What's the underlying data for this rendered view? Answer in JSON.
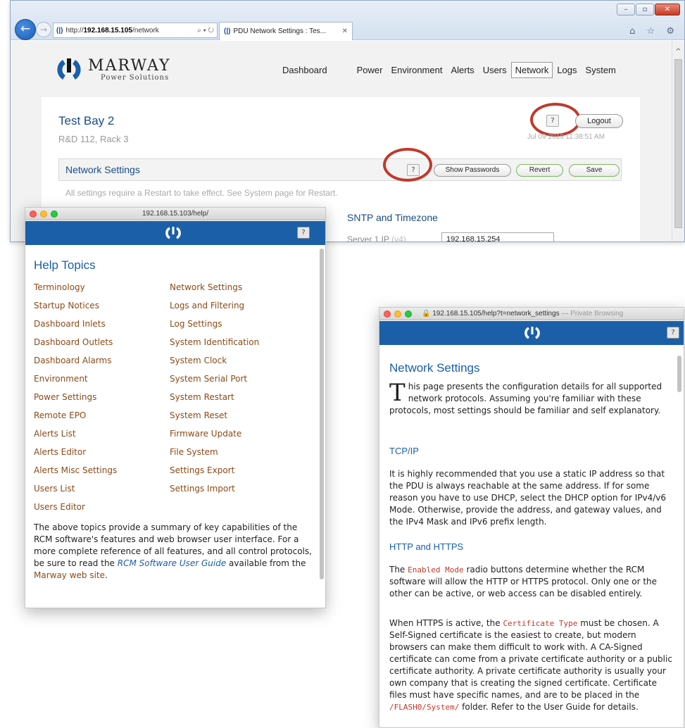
{
  "ie": {
    "window_controls": [
      "–",
      "▫",
      "✕"
    ],
    "url_prefix": "http://",
    "url_host": "192.168.15.105",
    "url_path": "/network",
    "addr_tools": "⌕ ▾ ↻",
    "tab_title": "PDU Network Settings : Tes...",
    "tab_close": "✕",
    "toolbar_icons": "⌂ ☆ ⚙",
    "scroll_up": "^"
  },
  "site": {
    "logo_name": "MARWAY",
    "logo_sub": "Power Solutions",
    "nav": [
      "Dashboard",
      "Power",
      "Environment",
      "Alerts",
      "Users",
      "Network",
      "Logs",
      "System"
    ],
    "active_nav": "Network",
    "title": "Test Bay 2",
    "subtitle": "R&D 112, Rack 3",
    "help_label": "?",
    "logout_label": "Logout",
    "timestamp": "Jul 09 2019 11:38:51 AM",
    "section_title": "Network Settings",
    "show_passwords_label": "Show Passwords",
    "revert_label": "Revert",
    "save_label": "Save",
    "note": "All settings require a Restart to take effect. See System page for Restart.",
    "sntp_title": "SNTP and Timezone",
    "server_label": "Server 1 IP",
    "server_label_suffix": "(v4)",
    "server_value": "192.168.15.254"
  },
  "help_index": {
    "window_url": "192.168.15.103/help/",
    "help_label": "?",
    "heading": "Help Topics",
    "topics_left": [
      "Terminology",
      "Startup Notices",
      "Dashboard Inlets",
      "Dashboard Outlets",
      "Dashboard Alarms",
      "Environment",
      "Power Settings",
      "Remote EPO",
      "Alerts List",
      "Alerts Editor",
      "Alerts Misc Settings",
      "Users List",
      "Users Editor"
    ],
    "topics_right": [
      "Network Settings",
      "Logs and Filtering",
      "Log Settings",
      "System Identification",
      "System Clock",
      "System Serial Port",
      "System Restart",
      "System Reset",
      "Firmware Update",
      "File System",
      "Settings Export",
      "Settings Import"
    ],
    "para_1": "The above topics provide a summary of key capabilities of the RCM software's features and web browser user interface. For a more complete reference of all features, and all control protocols, be sure to read the ",
    "para_link": "RCM Software User Guide",
    "para_2": " available from the ",
    "para_link_2": "Marway web site",
    "para_3": "."
  },
  "help_page": {
    "window_url": "192.168.15.105/help?t=network_settings",
    "private_note": " — Private Browsing",
    "help_label": "?",
    "heading": "Network Settings",
    "intro_cap": "T",
    "intro_rest": "his page presents the configuration details for all supported network protocols. Assuming you're familiar with these protocols, most settings should be familiar and self explanatory.",
    "tcp_heading": "TCP/IP",
    "tcp_para": "It is highly recommended that you use a static IP address so that the PDU is always reachable at the same address. If for some reason you have to use DHCP, select the DHCP option for IPv4/v6 Mode. Otherwise, provide the address, and gateway values, and the IPv4 Mask and IPv6 prefix length.",
    "http_heading": "HTTP and HTTPS",
    "http_p1_a": "The ",
    "http_p1_code": "Enabled Mode",
    "http_p1_b": " radio buttons determine whether the RCM software will allow the HTTP or HTTPS protocol. Only one or the other can be active, or web access can be disabled entirely.",
    "http_p2_a": "When HTTPS is active, the ",
    "http_p2_code": "Certificate Type",
    "http_p2_b": " must be chosen. A Self-Signed certificate is the easiest to create, but modern browsers can make them difficult to work with. A CA-Signed certificate can come from a private certificate authority or a public certificate authority. A private certificate authority is usually your own company that is creating the signed certificate. Certificate files must have specific names, and are to be placed in the ",
    "http_p2_code2": "/FLASH0/System/",
    "http_p2_c": " folder. Refer to the User Guide for details."
  },
  "colors": {
    "brand_blue": "#1a5fa8",
    "link_brown": "#8b4a18",
    "annotation_red": "#c0392b"
  }
}
